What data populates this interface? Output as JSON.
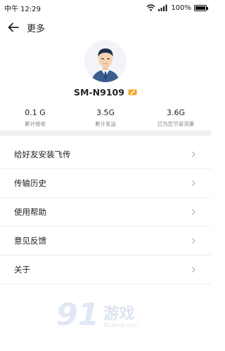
{
  "status": {
    "time": "中午 12:29",
    "battery": "100%",
    "battery_level": 1.0
  },
  "header": {
    "title": "更多"
  },
  "profile": {
    "device_name": "SM-N9109"
  },
  "stats": [
    {
      "value": "0.1 G",
      "label": "累计接收"
    },
    {
      "value": "3.5G",
      "label": "累计发送"
    },
    {
      "value": "3.6G",
      "label": "已为您节省流量"
    }
  ],
  "menu": [
    {
      "label": "给好友安装飞传"
    },
    {
      "label": "传输历史"
    },
    {
      "label": "使用帮助"
    },
    {
      "label": "意见反馈"
    },
    {
      "label": "关于"
    }
  ],
  "watermark": {
    "number": "91",
    "name": "游戏",
    "url": "91danji.com"
  },
  "colors": {
    "accent_badge": "#f5a623",
    "divider": "#f1f1f1",
    "label_gray": "#888888"
  }
}
